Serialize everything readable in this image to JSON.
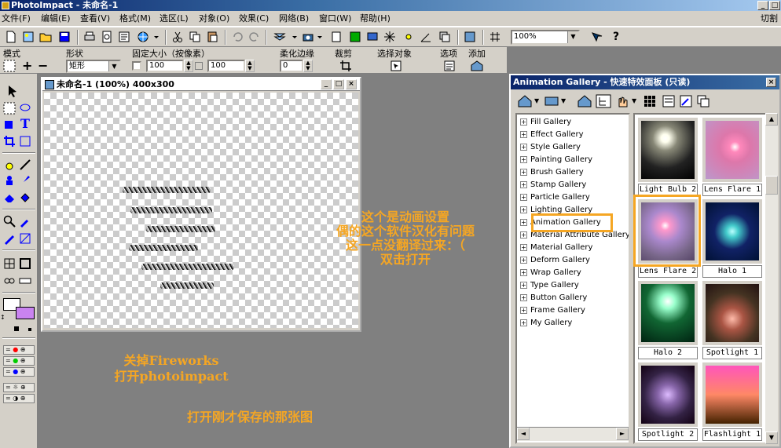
{
  "app": {
    "title": "PhotoImpact - 未命名-1",
    "window_buttons": [
      "_",
      "□",
      "×"
    ]
  },
  "menu": {
    "items": [
      "文件(F)",
      "编辑(E)",
      "查看(V)",
      "格式(M)",
      "选区(L)",
      "对象(O)",
      "效果(C)",
      "网络(B)",
      "窗口(W)",
      "帮助(H)"
    ],
    "right_label": "切割"
  },
  "toolbar": {
    "zoom_value": "100%",
    "help_glyph": "?"
  },
  "attrbar": {
    "labels": {
      "mode": "模式",
      "shape": "形状",
      "fixed_size": "固定大小（按像素）",
      "feather": "柔化边缘",
      "crop": "裁剪",
      "select_object": "选择对象",
      "options": "选项",
      "add": "添加"
    },
    "shape_value": "矩形",
    "width_value": "100",
    "height_value": "100",
    "feather_value": "0"
  },
  "document": {
    "title": "未命名-1 (100%) 400x300",
    "buttons": [
      "_",
      "□",
      "×"
    ]
  },
  "annotations": {
    "center": [
      "这个是动画设置",
      "偶的这个软件汉化有问题",
      "这一点没翻译过来：（",
      "双击打开"
    ],
    "left": [
      "关掉Fireworks",
      "打开photoimpact"
    ],
    "bottom": "打开刚才保存的那张图"
  },
  "gallery": {
    "title": "Animation Gallery - 快速特效面板 (只读)",
    "close": "×",
    "tree": [
      "Fill Gallery",
      "Effect Gallery",
      "Style Gallery",
      "Painting Gallery",
      "Brush Gallery",
      "Stamp Gallery",
      "Particle Gallery",
      "Lighting Gallery",
      "Animation Gallery",
      "Material Attribute Gallery",
      "Material Gallery",
      "Deform Gallery",
      "Wrap Gallery",
      "Type Gallery",
      "Button Gallery",
      "Frame Gallery",
      "My Gallery"
    ],
    "selected_tree_item": "Animation Gallery",
    "thumbnails": [
      {
        "caption": "Light Bulb 2",
        "style": "moon"
      },
      {
        "caption": "Lens Flare 1",
        "style": "flare-pink"
      },
      {
        "caption": "Lens Flare 2",
        "style": "flare-purple"
      },
      {
        "caption": "Halo 1",
        "style": "halo-blue"
      },
      {
        "caption": "Halo 2",
        "style": "forest"
      },
      {
        "caption": "Spotlight 1",
        "style": "statue-red"
      },
      {
        "caption": "Spotlight 2",
        "style": "statue-purple"
      },
      {
        "caption": "Flashlight 1",
        "style": "palm-sunset"
      }
    ],
    "selected_thumbnail": "Lens Flare 2"
  },
  "colors": {
    "annotation": "#f5a623",
    "highlight": "#f5a623",
    "foreground_swatch": "#ffffff",
    "background_swatch": "#c983f0"
  }
}
